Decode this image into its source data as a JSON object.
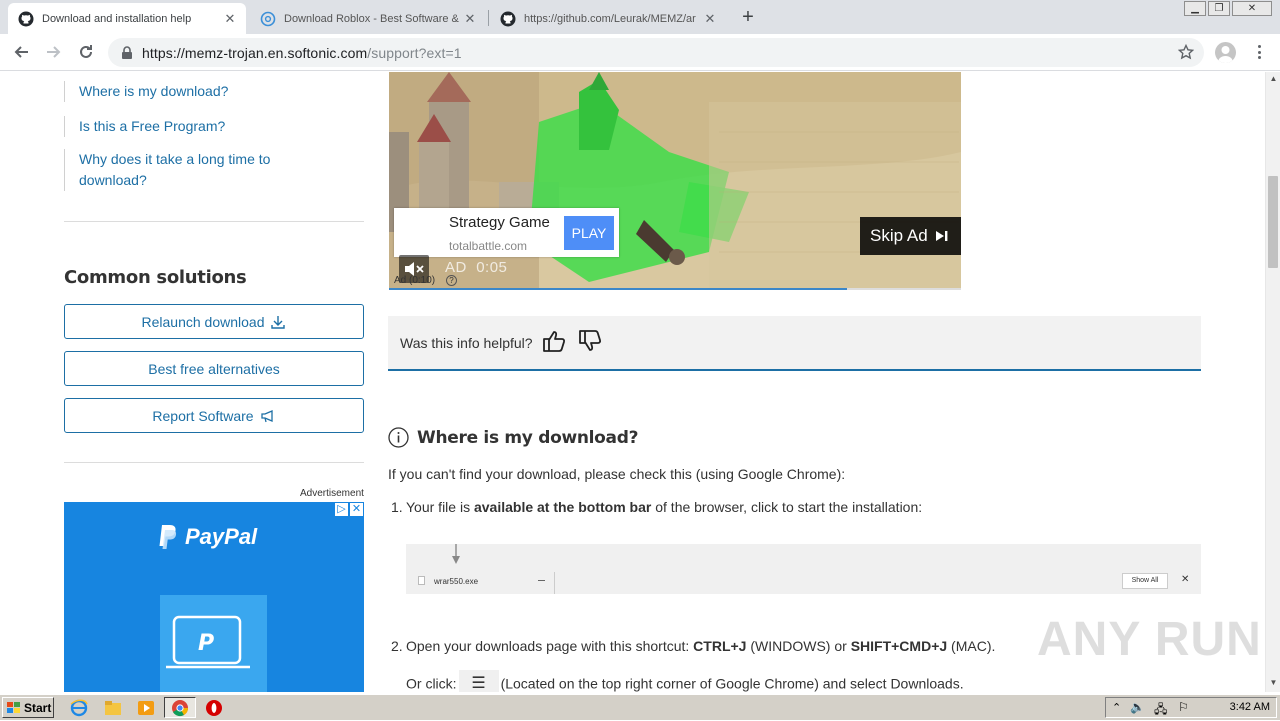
{
  "browser": {
    "tabs": [
      {
        "title": "Download and installation help",
        "active": true,
        "icon": "github-icon"
      },
      {
        "title": "Download Roblox - Best Software &",
        "active": false,
        "icon": "softonic-icon"
      },
      {
        "title": "https://github.com/Leurak/MEMZ/ar",
        "active": false,
        "icon": "github-icon"
      }
    ],
    "url_host": "https://memz-trojan.en.softonic.com",
    "url_path": "/support?ext=1"
  },
  "sidebar": {
    "faq_links": [
      "Where is my download?",
      "Is this a Free Program?",
      "Why does it take a long time to download?"
    ],
    "common_solutions_heading": "Common solutions",
    "buttons": [
      "Relaunch download",
      "Best free alternatives",
      "Report Software"
    ],
    "advertisement_caption": "Advertisement",
    "paypal_ad": {
      "brand": "PayPal",
      "accent": "#1785e0"
    }
  },
  "video_ad": {
    "game": "Strategy Game",
    "site": "totalbattle.com",
    "play_label": "PLAY",
    "skip_label": "Skip Ad",
    "timer_label": "AD",
    "timer_value": "0:05",
    "counter": "Ad (0:10)",
    "progress": 0.8
  },
  "feedback": {
    "question": "Was this info helpful?"
  },
  "article": {
    "section_title": "Where is my download?",
    "intro": "If you can't find your download, please check this (using Google Chrome):",
    "step1_num": "1.",
    "step1_pre": "Your file is ",
    "step1_bold": "available at the bottom bar",
    "step1_post": " of the browser, click to start the installation:",
    "download_bar": {
      "file": "wrar550.exe",
      "show_all": "Show All",
      "close": "✕"
    },
    "step2_num": "2.",
    "step2_pre": "Open your downloads page with this shortcut: ",
    "step2_key1": "CTRL+J",
    "step2_mid": " (WINDOWS) or ",
    "step2_key2": "SHIFT+CMD+J",
    "step2_post": " (MAC).",
    "step2b_pre": "Or click:",
    "step2b_post": "(Located on the top right corner of Google Chrome) and select Downloads."
  },
  "watermark": "ANY RUN",
  "taskbar": {
    "start_label": "Start",
    "clock": "3:42 AM"
  }
}
